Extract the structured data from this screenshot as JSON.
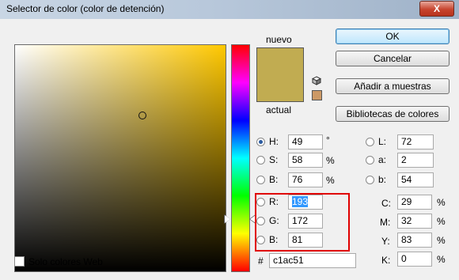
{
  "window": {
    "title": "Selector de color (color de detención)",
    "close_label": "X"
  },
  "preview": {
    "new_label": "nuevo",
    "current_label": "actual",
    "new_color": "#c1ac51",
    "current_color": "#c1ac51"
  },
  "buttons": {
    "ok": "OK",
    "cancel": "Cancelar",
    "add_swatches": "Añadir a muestras",
    "libraries": "Bibliotecas de colores"
  },
  "hsb": {
    "h": {
      "label": "H:",
      "value": "49",
      "unit": "°"
    },
    "s": {
      "label": "S:",
      "value": "58",
      "unit": "%"
    },
    "b": {
      "label": "B:",
      "value": "76",
      "unit": "%"
    }
  },
  "rgb": {
    "r": {
      "label": "R:",
      "value": "193"
    },
    "g": {
      "label": "G:",
      "value": "172"
    },
    "b": {
      "label": "B:",
      "value": "81"
    }
  },
  "lab": {
    "l": {
      "label": "L:",
      "value": "72"
    },
    "a": {
      "label": "a:",
      "value": "2"
    },
    "b": {
      "label": "b:",
      "value": "54"
    }
  },
  "cmyk": {
    "c": {
      "label": "C:",
      "value": "29",
      "unit": "%"
    },
    "m": {
      "label": "M:",
      "value": "32",
      "unit": "%"
    },
    "y": {
      "label": "Y:",
      "value": "83",
      "unit": "%"
    },
    "k": {
      "label": "K:",
      "value": "0",
      "unit": "%"
    }
  },
  "hex": {
    "label": "#",
    "value": "c1ac51"
  },
  "web_only": {
    "label": "Solo colores Web",
    "checked": false
  },
  "colors": {
    "hue_base": "#ffc800",
    "highlight": "#e00000"
  }
}
